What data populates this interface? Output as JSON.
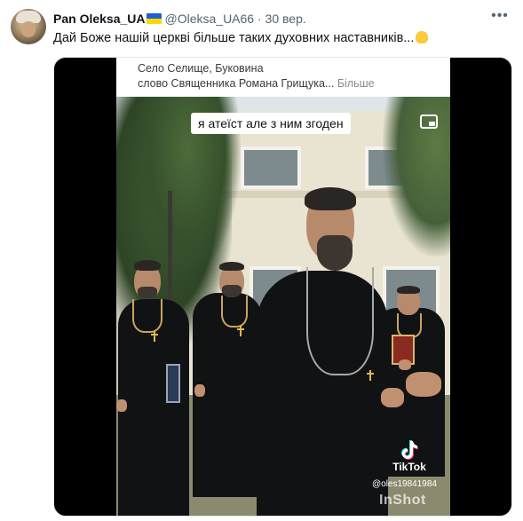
{
  "tweet": {
    "display_name": "Pan Oleksa_UA",
    "handle": "@Oleksa_UA66",
    "separator": "·",
    "time": "30 вер.",
    "text": "Дай Боже нашій церкві більше таких духовних наставників...",
    "more_icon": "more-horizontal-icon"
  },
  "video": {
    "caption_line1": "Село Селище, Буковина",
    "caption_line2": "слово Священника Романа Грищука...",
    "caption_more": "Більше",
    "overlay_text": "я атеїст але з ним згоден",
    "tiktok_brand": "TikTok",
    "tiktok_user": "@oles19841984",
    "watermark": "InShot"
  },
  "colors": {
    "text_primary": "#0f1419",
    "text_secondary": "#536471",
    "media_bg": "#000000"
  }
}
